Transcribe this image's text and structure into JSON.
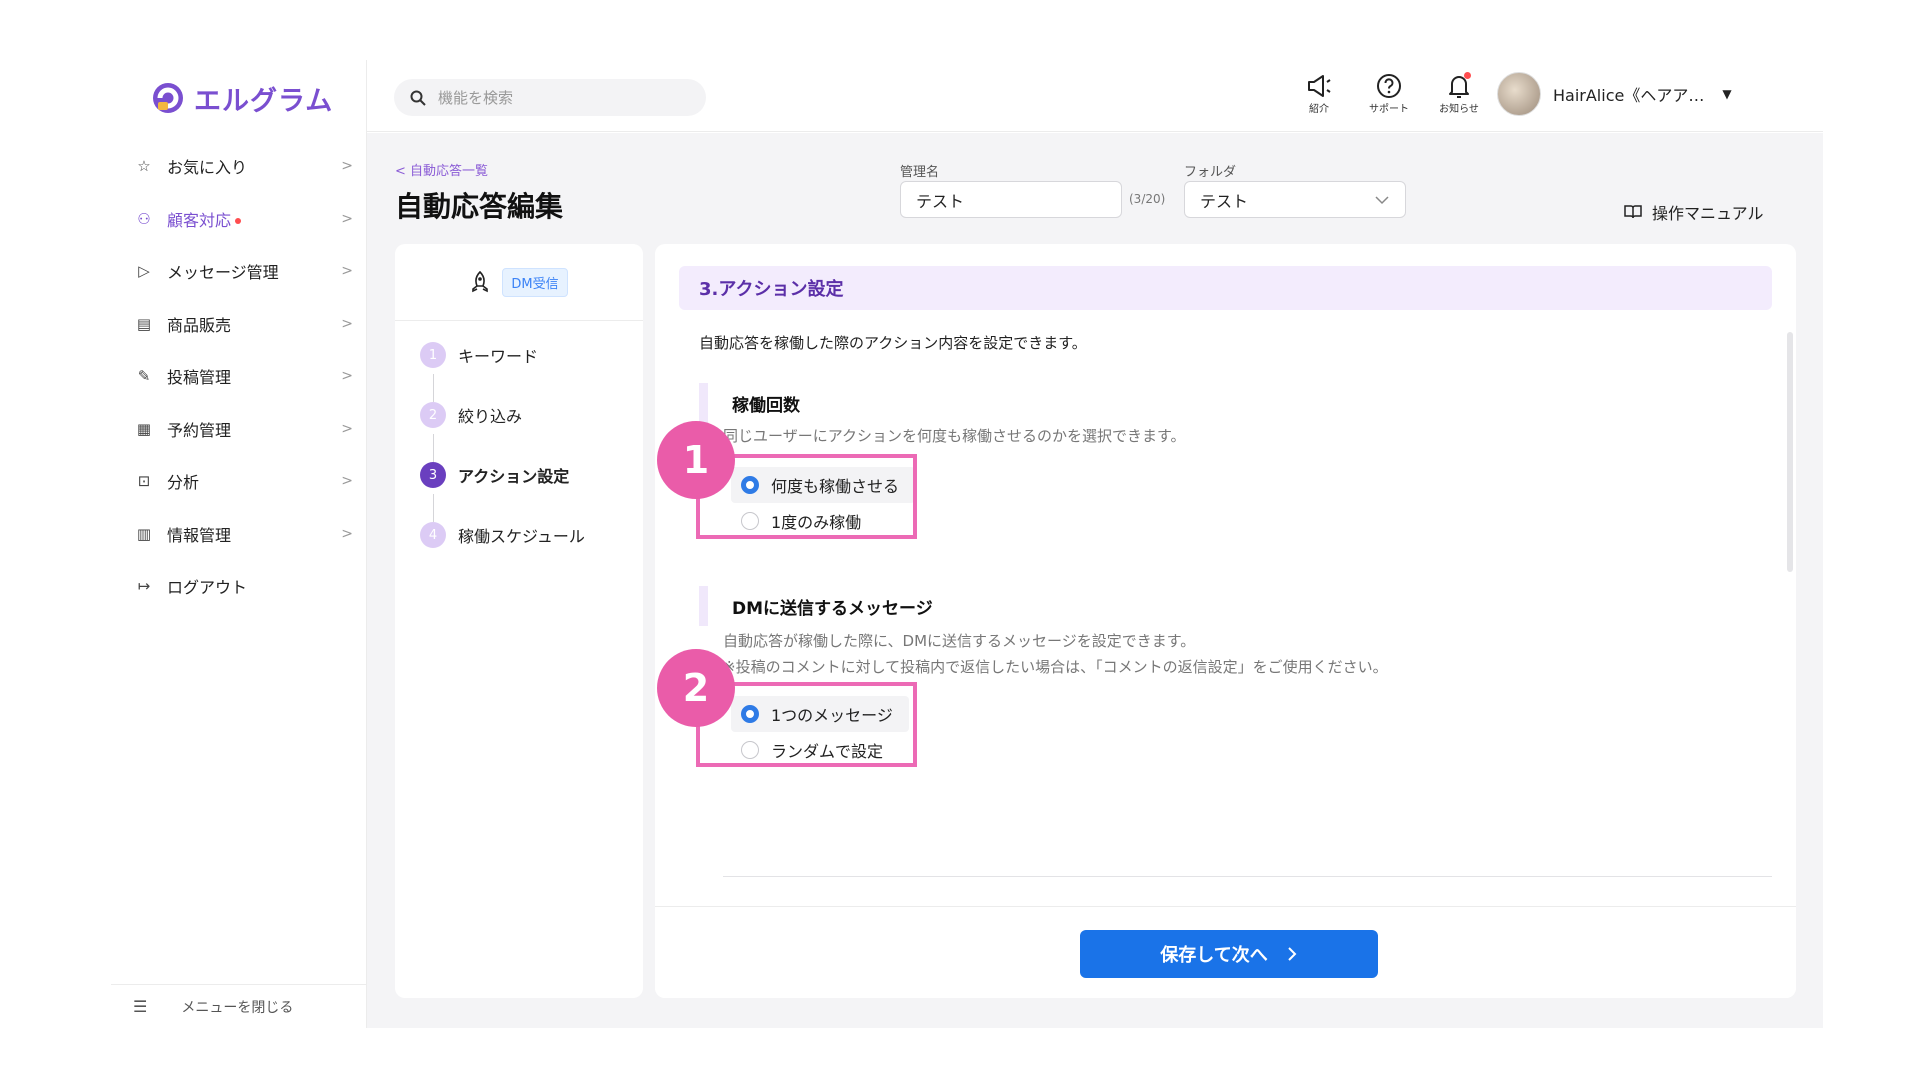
{
  "app": {
    "logo_text": "エルグラム"
  },
  "sidebar": {
    "items": [
      {
        "label": "お気に入り",
        "icon": "star-icon",
        "glyph": "☆"
      },
      {
        "label": "顧客対応",
        "icon": "user-icon",
        "glyph": "⚇"
      },
      {
        "label": "メッセージ管理",
        "icon": "send-icon",
        "glyph": "▷"
      },
      {
        "label": "商品販売",
        "icon": "store-icon",
        "glyph": "▤"
      },
      {
        "label": "投稿管理",
        "icon": "edit-icon",
        "glyph": "✎"
      },
      {
        "label": "予約管理",
        "icon": "calendar-icon",
        "glyph": "▦"
      },
      {
        "label": "分析",
        "icon": "analysis-icon",
        "glyph": "⊡"
      },
      {
        "label": "情報管理",
        "icon": "chart-icon",
        "glyph": "▥"
      },
      {
        "label": "ログアウト",
        "icon": "logout-icon",
        "glyph": "↦"
      }
    ],
    "chevron": ">",
    "collapse_label": "メニューを閉じる"
  },
  "header": {
    "search_placeholder": "機能を検索",
    "icons": [
      {
        "label": "紹介",
        "icon": "megaphone-icon",
        "glyph": "◁"
      },
      {
        "label": "サポート",
        "icon": "help-icon",
        "glyph": "ⓘ"
      },
      {
        "label": "お知らせ",
        "icon": "bell-icon",
        "glyph": "♫"
      }
    ],
    "user_name": "HairAlice《ヘアア…"
  },
  "page": {
    "back_link": "自動応答一覧",
    "title": "自動応答編集",
    "name_label": "管理名",
    "name_value": "テスト",
    "name_counter": "(3/20)",
    "folder_label": "フォルダ",
    "folder_value": "テスト",
    "manual_label": "操作マニュアル"
  },
  "steps": {
    "trigger_tag": "DM受信",
    "items": [
      {
        "num": "1",
        "label": "キーワード"
      },
      {
        "num": "2",
        "label": "絞り込み"
      },
      {
        "num": "3",
        "label": "アクション設定"
      },
      {
        "num": "4",
        "label": "稼働スケジュール"
      }
    ]
  },
  "main": {
    "section_title": "3.アクション設定",
    "section_desc": "自動応答を稼働した際のアクション内容を設定できます。",
    "run_count": {
      "title": "稼働回数",
      "desc": "同じユーザーにアクションを何度も稼働させるのかを選択できます。",
      "options": [
        "何度も稼働させる",
        "1度のみ稼働"
      ],
      "selected": 0
    },
    "dm_message": {
      "title": "DMに送信するメッセージ",
      "desc1": "自動応答が稼働した際に、DMに送信するメッセージを設定できます。",
      "desc2": "※投稿のコメントに対して投稿内で返信したい場合は、「コメントの返信設定」をご使用ください。",
      "options": [
        "1つのメッセージ",
        "ランダムで設定"
      ],
      "selected": 0
    },
    "callouts": [
      "1",
      "2"
    ],
    "save_label": "保存して次へ"
  },
  "colors": {
    "brand": "#7a4fd0",
    "primary_button": "#1a73e8",
    "highlight": "#ec6ab5",
    "section_bg": "#f3ecfd"
  }
}
